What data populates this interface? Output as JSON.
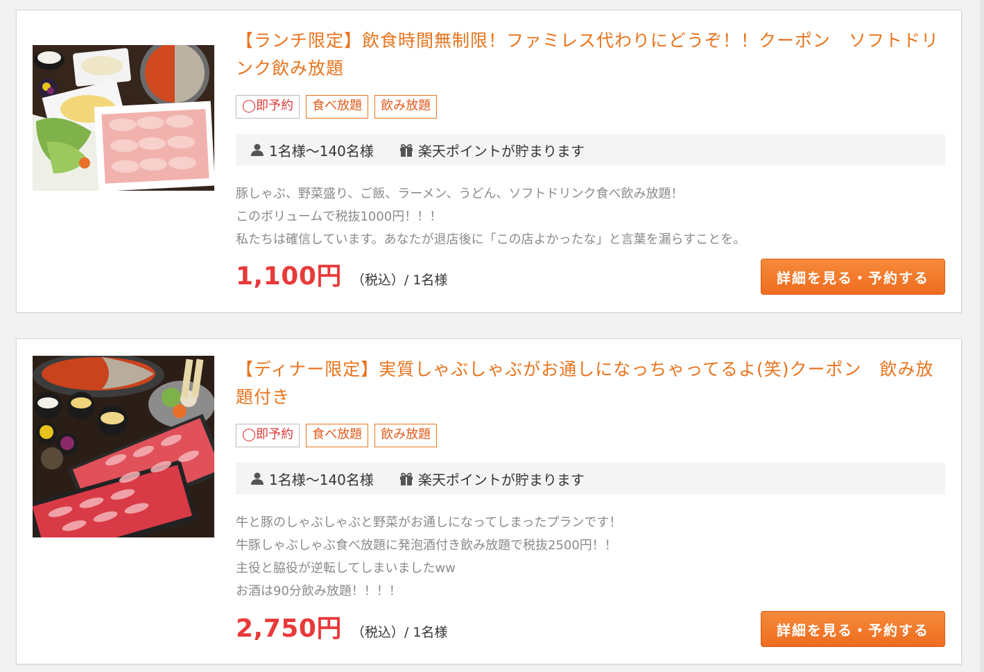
{
  "plans": [
    {
      "title": "【ランチ限定】飲食時間無制限！ファミレス代わりにどうぞ！！クーポン　ソフトドリンク飲み放題",
      "photo_icon": "shabu-lunch-photo",
      "tags": [
        "◯即予約",
        "食べ放題",
        "飲み放題"
      ],
      "guests": "1名様〜140名様",
      "points": "楽天ポイントが貯まります",
      "description": [
        "豚しゃぶ、野菜盛り、ご飯、ラーメン、うどん、ソフトドリンク食べ飲み放題！",
        "このボリュームで税抜1000円！！！",
        "私たちは確信しています。あなたが退店後に「この店よかったな」と言葉を漏らすことを。"
      ],
      "price": "1,100円",
      "price_note": "（税込）/ 1名様",
      "button_label": "詳細を見る・予約する"
    },
    {
      "title": "【ディナー限定】実質しゃぶしゃぶがお通しになっちゃってるよ(笑)クーポン　飲み放題付き",
      "photo_icon": "shabu-dinner-photo",
      "tags": [
        "◯即予約",
        "食べ放題",
        "飲み放題"
      ],
      "guests": "1名様〜140名様",
      "points": "楽天ポイントが貯まります",
      "description": [
        "牛と豚のしゃぶしゃぶと野菜がお通しになってしまったプランです！",
        "牛豚しゃぶしゃぶ食べ放題に発泡酒付き飲み放題で税抜2500円！！",
        "主役と脇役が逆転してしまいましたww",
        "お酒は90分飲み放題！！！！"
      ],
      "price": "2,750円",
      "price_note": "（税込）/ 1名様",
      "button_label": "詳細を見る・予約する"
    }
  ],
  "colors": {
    "title": "#e8731c",
    "price": "#e83a3a",
    "button": "#ef7a2a",
    "tag_border": "#e8731c"
  },
  "icons": {
    "guests": "person-icon",
    "points": "gift-icon"
  }
}
